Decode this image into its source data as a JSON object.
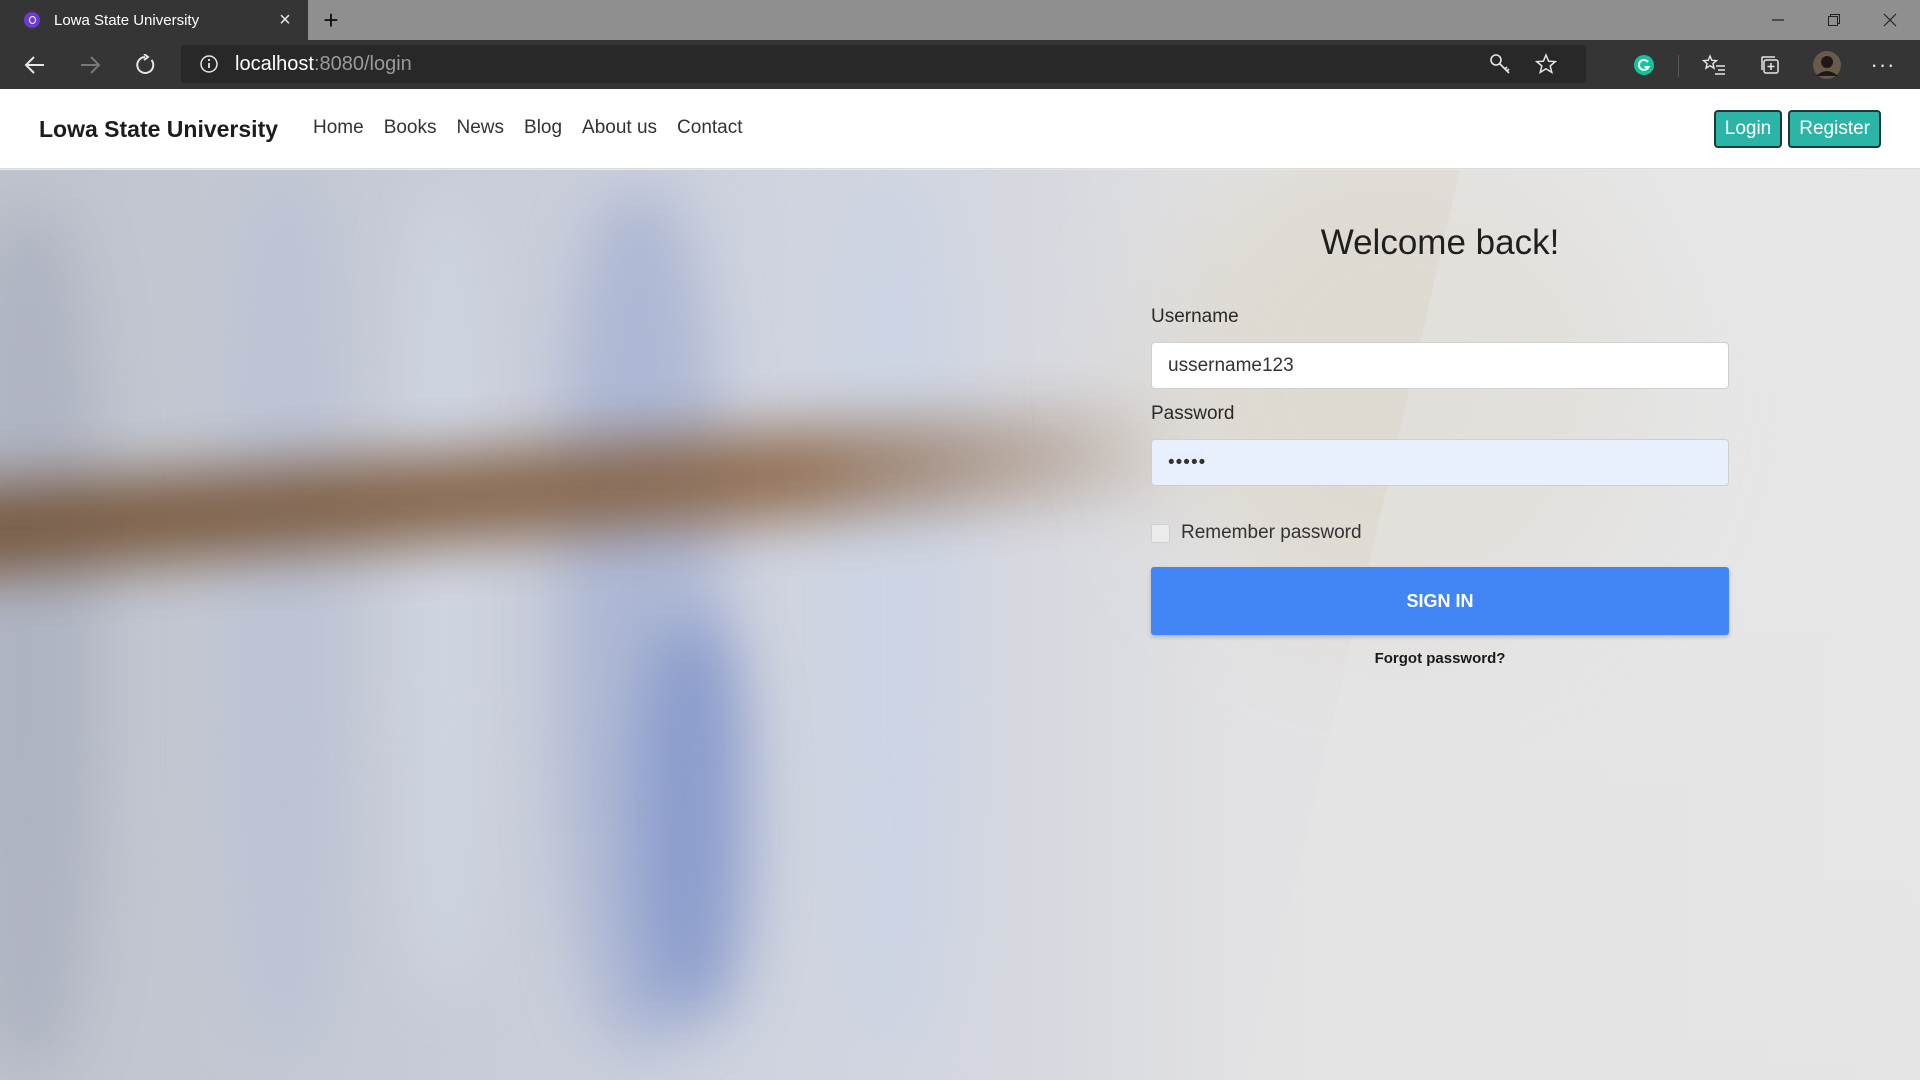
{
  "browser": {
    "tab_title": "Lowa State University",
    "tab_close": "×",
    "new_tab": "+",
    "url_host": "localhost",
    "url_path": ":8080/login",
    "more_menu": "···",
    "colors": {
      "tabstrip": "#8f8f8f",
      "toolbar": "#353535",
      "favicon": "#6b3bd8",
      "grammarly": "#15c39a"
    }
  },
  "navbar": {
    "brand": "Lowa State University",
    "links": [
      "Home",
      "Books",
      "News",
      "Blog",
      "About us",
      "Contact"
    ],
    "login_label": "Login",
    "register_label": "Register",
    "accent_color": "#2bb5a7"
  },
  "login": {
    "title": "Welcome back!",
    "username_label": "Username",
    "username_value": "ussername123",
    "password_label": "Password",
    "password_value": "•••••",
    "remember_label": "Remember password",
    "remember_checked": false,
    "signin_label": "SIGN IN",
    "forgot_label": "Forgot password?",
    "signin_color": "#4285f4"
  }
}
